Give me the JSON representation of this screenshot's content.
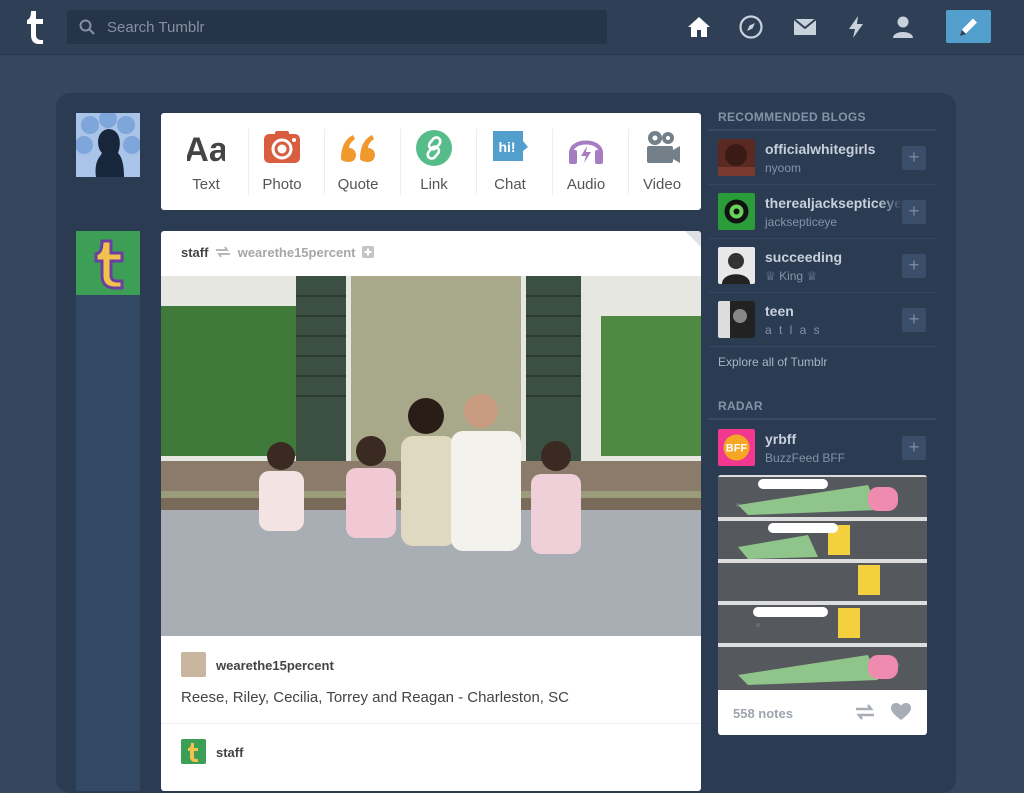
{
  "header": {
    "search_placeholder": "Search Tumblr",
    "nav": [
      "home-icon",
      "explore-icon",
      "inbox-icon",
      "activity-icon",
      "account-icon"
    ],
    "compose_icon": "pencil-icon",
    "accent": "#529ecc"
  },
  "post_bar": {
    "items": [
      {
        "label": "Text",
        "icon": "text-icon",
        "color": "#444444"
      },
      {
        "label": "Photo",
        "icon": "camera-icon",
        "color": "#d95e40"
      },
      {
        "label": "Quote",
        "icon": "quote-icon",
        "color": "#f2992e"
      },
      {
        "label": "Link",
        "icon": "link-icon",
        "color": "#56bc8a"
      },
      {
        "label": "Chat",
        "icon": "chat-icon",
        "color": "#529ecc"
      },
      {
        "label": "Audio",
        "icon": "headphones-icon",
        "color": "#a77dc2"
      },
      {
        "label": "Video",
        "icon": "video-camera-icon",
        "color": "#748089"
      }
    ]
  },
  "post": {
    "author": "staff",
    "reblogged_from": "wearethe15percent",
    "source_name": "wearethe15percent",
    "caption": "Reese, Riley, Cecilia, Torrey and Reagan - Charleston, SC",
    "next_author": "staff"
  },
  "sidebar": {
    "recommended_title": "RECOMMENDED BLOGS",
    "blogs": [
      {
        "name": "officialwhitegirls",
        "sub": "nyoom",
        "color": "#7a3b2e"
      },
      {
        "name": "therealjacksepticeye",
        "sub": "jacksepticeye",
        "color": "#2a9d3a"
      },
      {
        "name": "succeeding",
        "sub": "♕ King ♕",
        "color": "#444444"
      },
      {
        "name": "teen",
        "sub": "a t l a s",
        "color": "#555555"
      }
    ],
    "explore_label": "Explore all of Tumblr",
    "radar_title": "RADAR",
    "radar": {
      "name": "yrbff",
      "sub": "BuzzFeed BFF",
      "notes": "558 notes"
    }
  }
}
